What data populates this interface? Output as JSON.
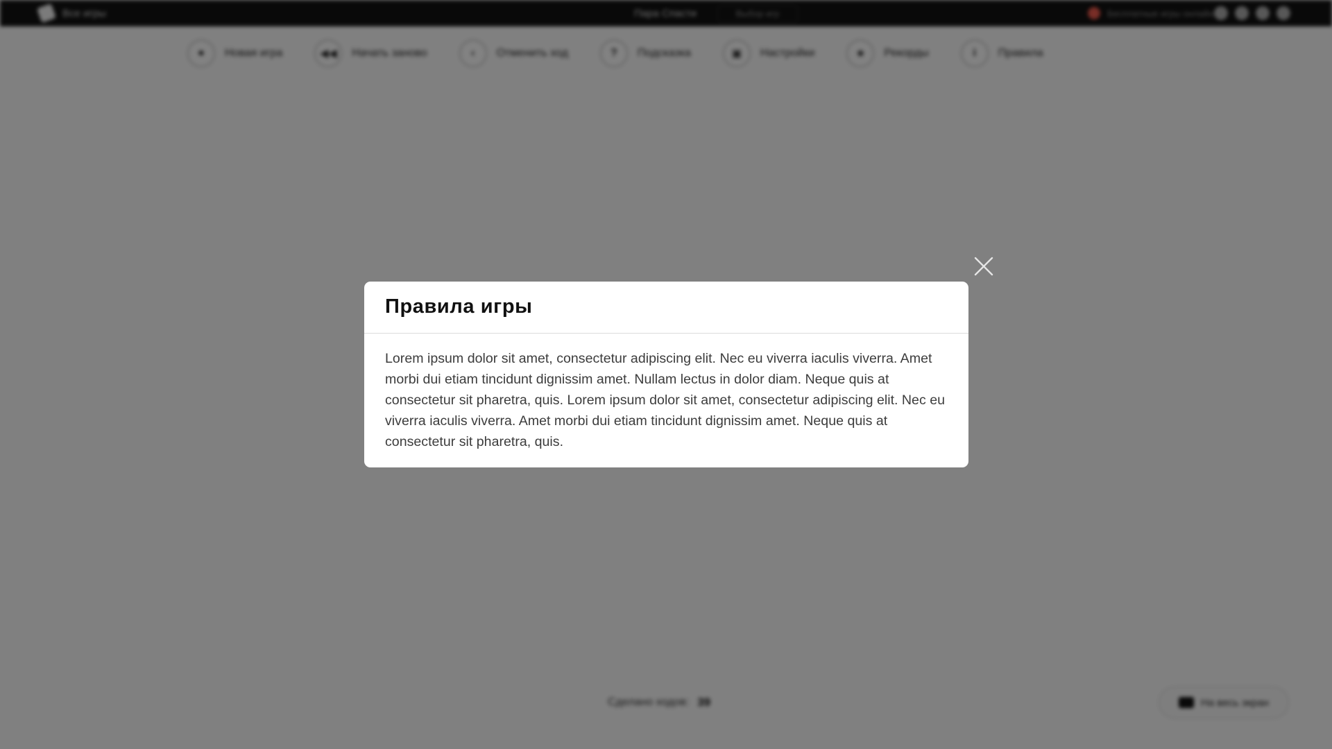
{
  "topbar": {
    "brand_label": "Все игры",
    "game_title": "Пара Спасти",
    "choose_label": "Выбор игр",
    "promo_label": "Бесплатные игры онлайн"
  },
  "toolbar": {
    "items": [
      {
        "icon": "new-game-icon",
        "glyph": "●",
        "label": "Новая игра"
      },
      {
        "icon": "restart-icon",
        "glyph": "◀◀",
        "label": "Начать заново"
      },
      {
        "icon": "undo-icon",
        "glyph": "‹",
        "label": "Отменить ход"
      },
      {
        "icon": "hint-icon",
        "glyph": "?",
        "label": "Подсказка"
      },
      {
        "icon": "settings-icon",
        "glyph": "▣",
        "label": "Настройки"
      },
      {
        "icon": "records-icon",
        "glyph": "★",
        "label": "Рекорды"
      },
      {
        "icon": "rules-icon",
        "glyph": "i",
        "label": "Правила"
      }
    ]
  },
  "footer": {
    "moves_label": "Сделано ходов:",
    "moves_value": "39",
    "fullscreen_label": "На весь экран"
  },
  "modal": {
    "title": "Правила игры",
    "body": "Lorem ipsum dolor sit amet, consectetur adipiscing elit. Nec eu viverra iaculis viverra. Amet morbi dui etiam tincidunt dignissim amet. Nullam lectus in dolor diam. Neque quis at consectetur sit pharetra, quis. Lorem ipsum dolor sit amet, consectetur adipiscing elit. Nec eu viverra iaculis viverra. Amet morbi dui etiam tincidunt dignissim amet. Neque quis at consectetur sit pharetra, quis."
  },
  "colors": {
    "overlay": "#000000",
    "modal_bg": "#ffffff",
    "title": "#111111",
    "text": "#3c3c3c"
  }
}
